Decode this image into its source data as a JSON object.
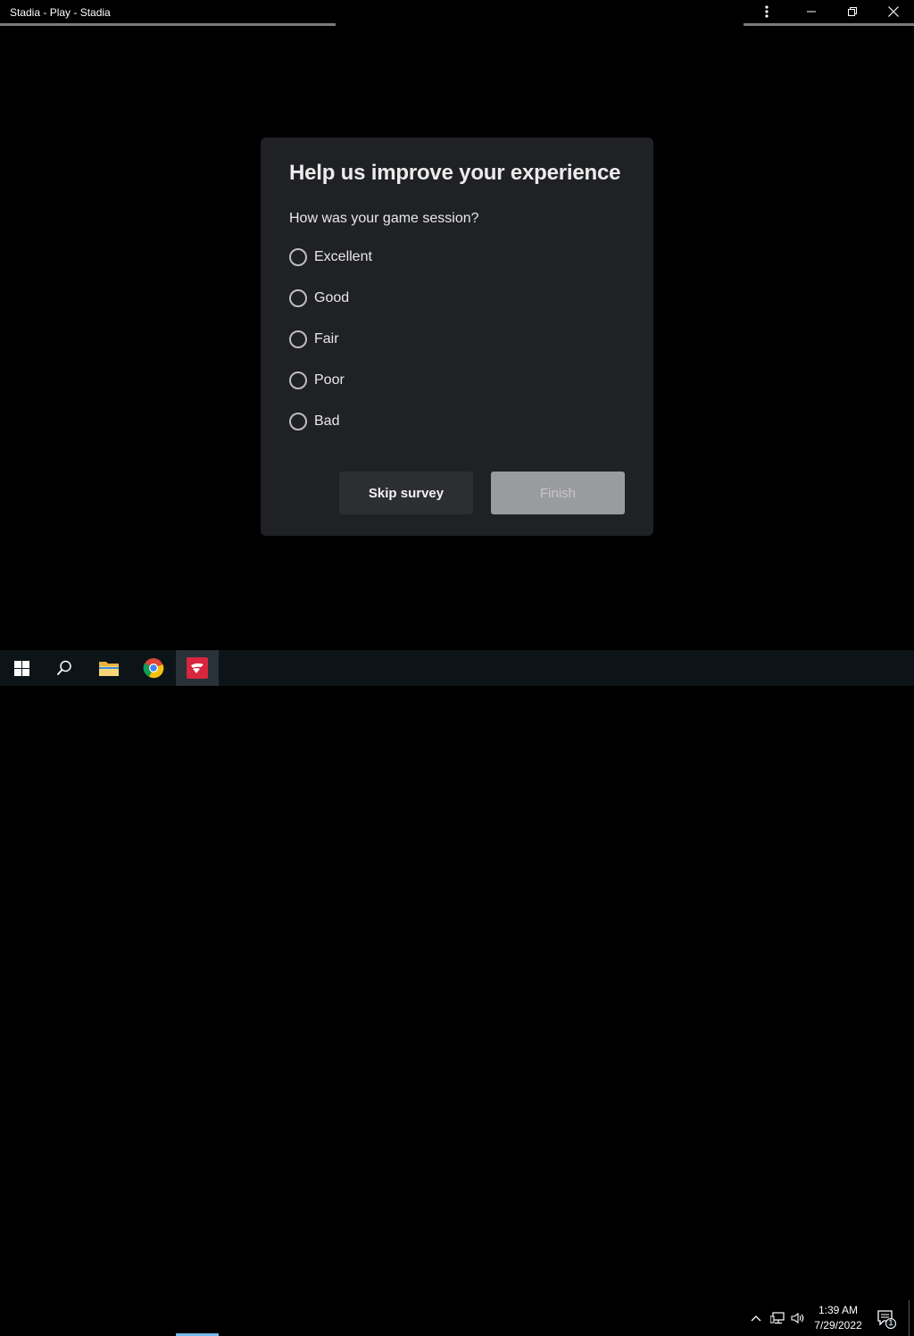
{
  "window": {
    "title": "Stadia - Play - Stadia",
    "controls": [
      "kebab-menu-icon",
      "minimize-icon",
      "restore-icon",
      "close-icon"
    ]
  },
  "dialog": {
    "title": "Help us improve your experience",
    "question": "How was your game session?",
    "options": [
      {
        "label": "Excellent",
        "selected": false
      },
      {
        "label": "Good",
        "selected": false
      },
      {
        "label": "Fair",
        "selected": false
      },
      {
        "label": "Poor",
        "selected": false
      },
      {
        "label": "Bad",
        "selected": false
      }
    ],
    "skip_label": "Skip survey",
    "finish_label": "Finish",
    "finish_enabled": false
  },
  "taskbar": {
    "items": [
      "windows-start-icon",
      "search-icon",
      "file-explorer-icon",
      "chrome-icon",
      "stadia-icon"
    ],
    "active_item": "stadia-icon",
    "tray_icons": [
      "chevron-up-icon",
      "network-icon",
      "volume-icon"
    ],
    "time": "1:39 AM",
    "date": "7/29/2022",
    "notification_count": "1"
  },
  "colors": {
    "background": "#000000",
    "dialog_bg": "#202124",
    "skip_btn_bg": "#2d2e31",
    "finish_btn_bg": "#9a9b9d",
    "taskbar_bg": "#0d1418",
    "active_underline": "#76b9ed"
  }
}
